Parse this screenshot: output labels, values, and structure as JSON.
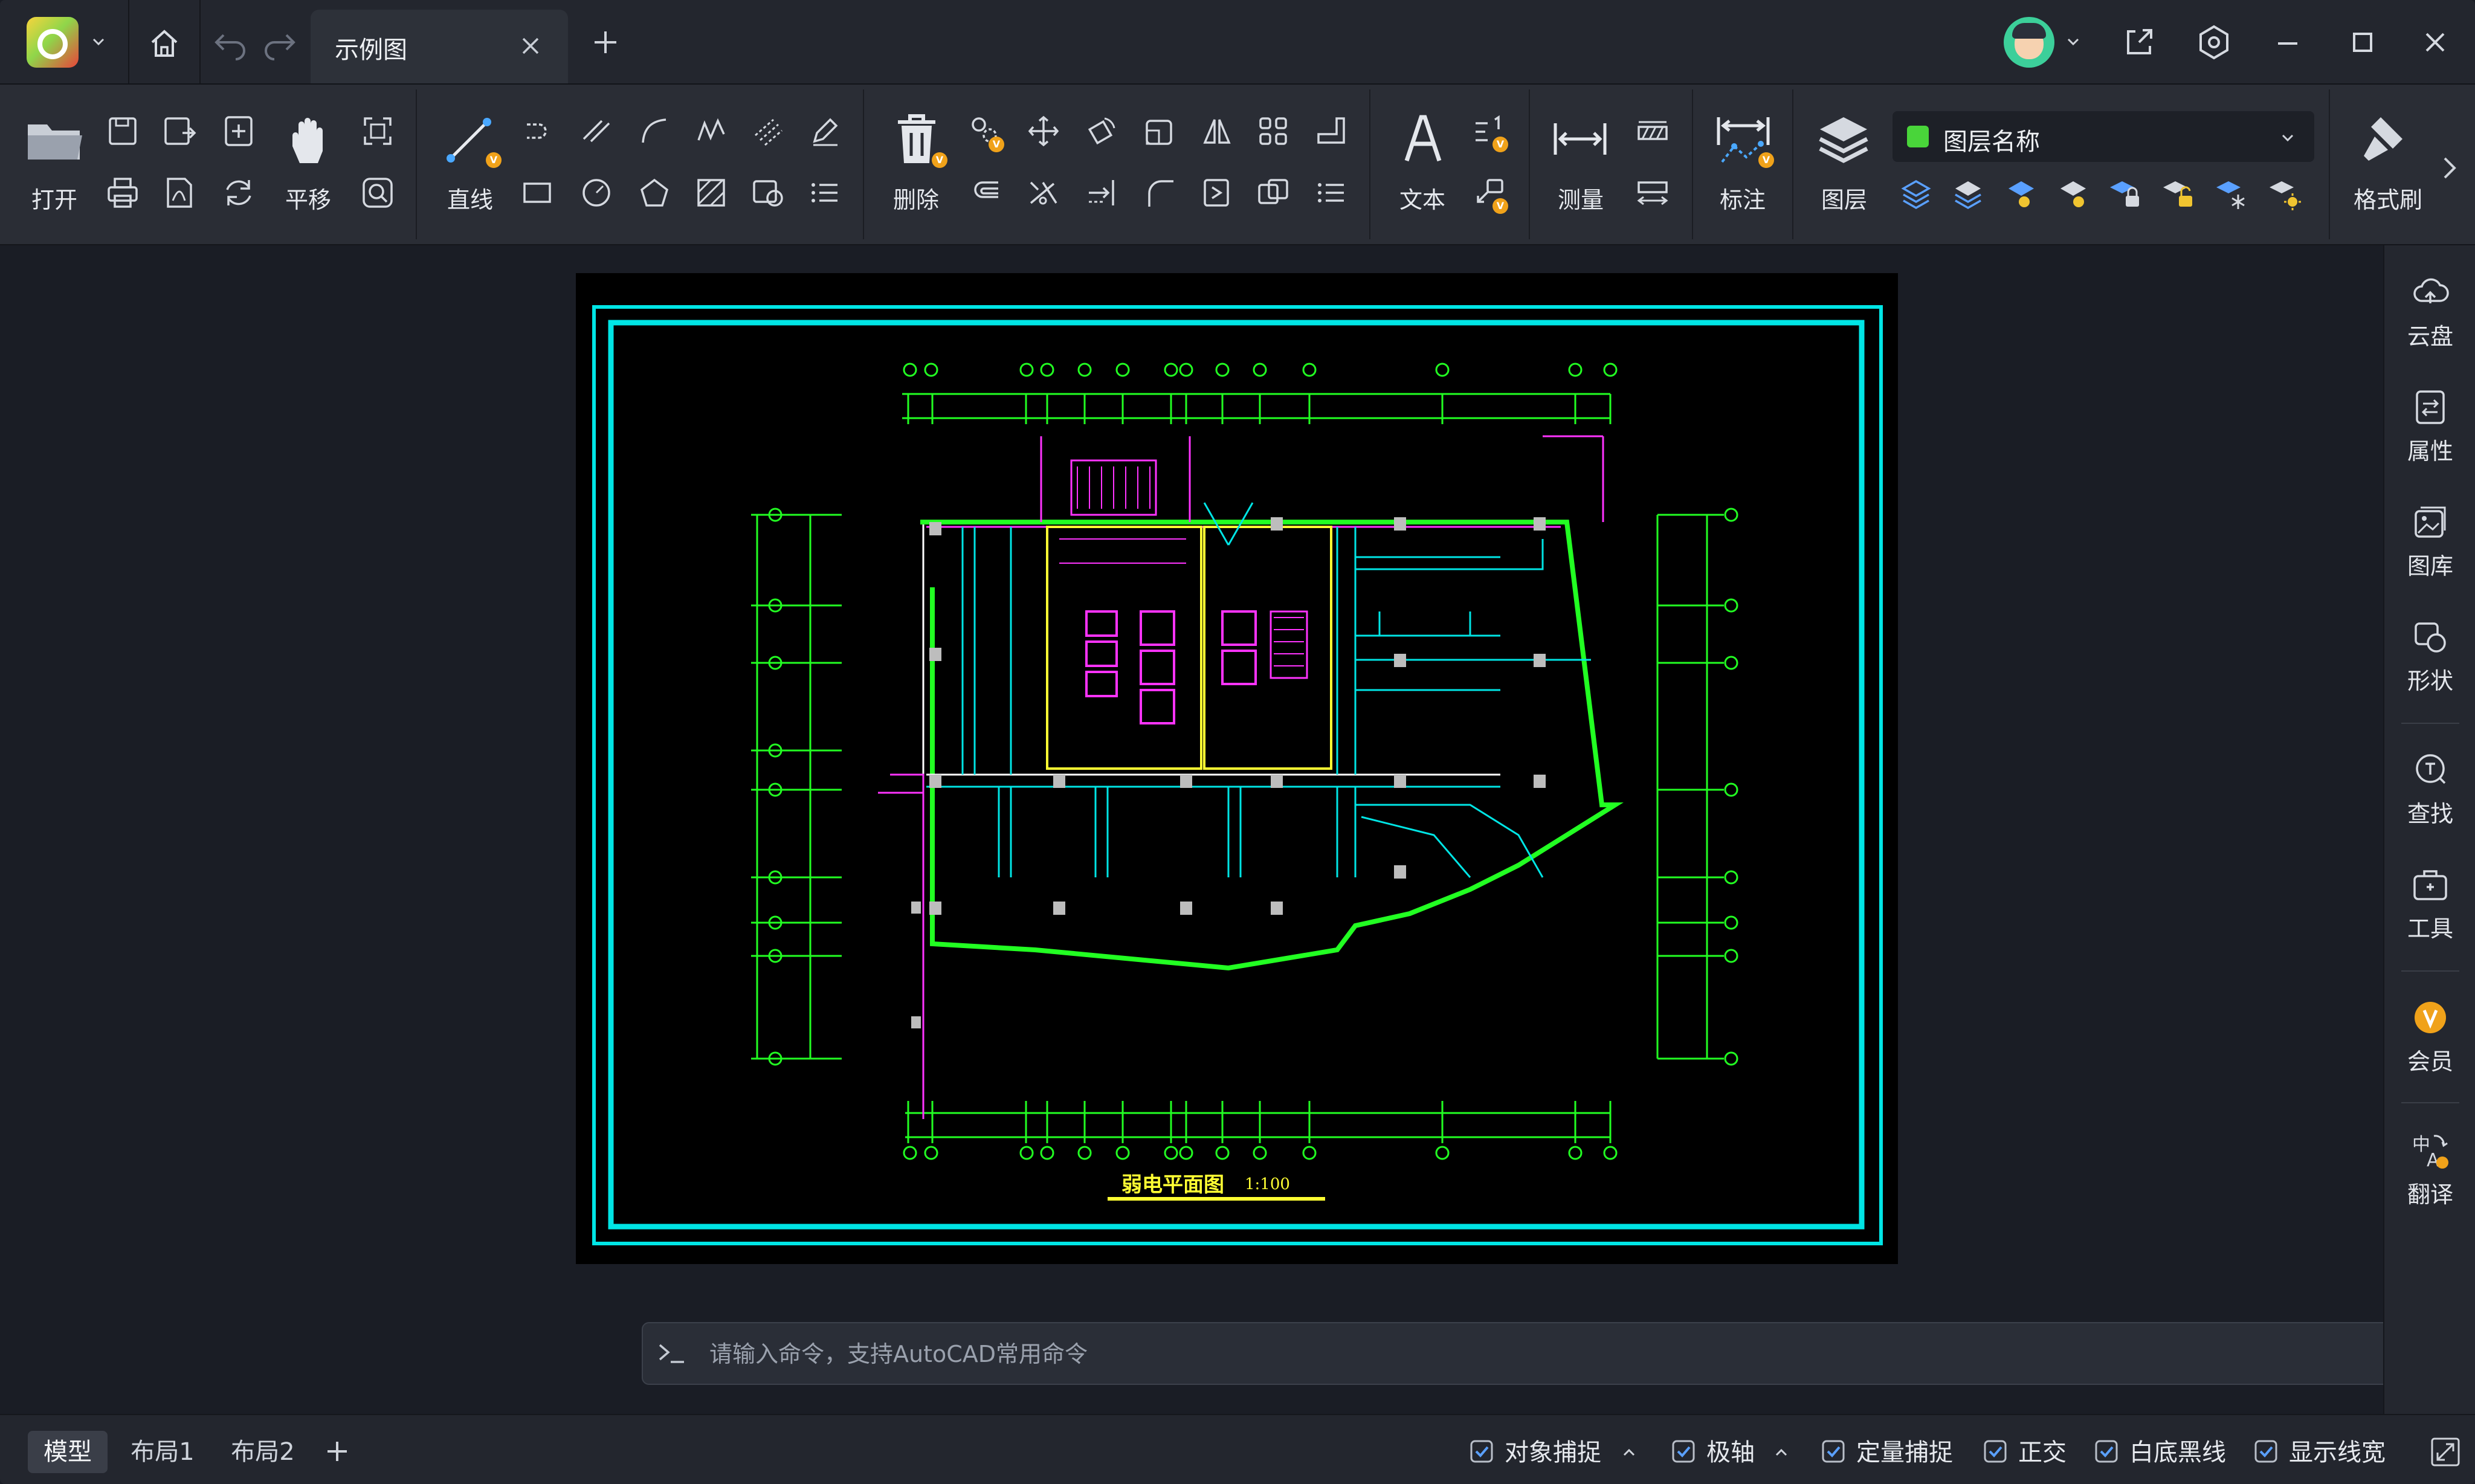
{
  "titlebar": {
    "tab_title": "示例图"
  },
  "ribbon": {
    "open_label": "打开",
    "pan_label": "平移",
    "line_label": "直线",
    "delete_label": "删除",
    "text_label": "文本",
    "measure_label": "测量",
    "dimension_label": "标注",
    "layer_label": "图层",
    "layer_name": "图层名称",
    "format_painter_label": "格式刷",
    "vip_badge": "V"
  },
  "drawing": {
    "plan_title": "弱电平面图",
    "plan_scale": "1:100"
  },
  "right_panel": {
    "cloud": "云盘",
    "properties": "属性",
    "gallery": "图库",
    "shapes": "形状",
    "find": "查找",
    "tools": "工具",
    "member": "会员",
    "translate": "翻译"
  },
  "command": {
    "placeholder": "请输入命令，支持AutoCAD常用命令"
  },
  "statusbar": {
    "tabs": [
      "模型",
      "布局1",
      "布局2"
    ],
    "object_snap": "对象捕捉",
    "polar": "极轴",
    "quant_snap": "定量捕捉",
    "ortho": "正交",
    "white_black": "白底黑线",
    "show_lineweight": "显示线宽"
  },
  "colors": {
    "accent_cyan": "#00e5e5",
    "cad_green": "#22ff22",
    "cad_magenta": "#ff33ff",
    "cad_yellow": "#ffff33",
    "vip_orange": "#f0a21a",
    "check_blue": "#5aa0ff"
  }
}
